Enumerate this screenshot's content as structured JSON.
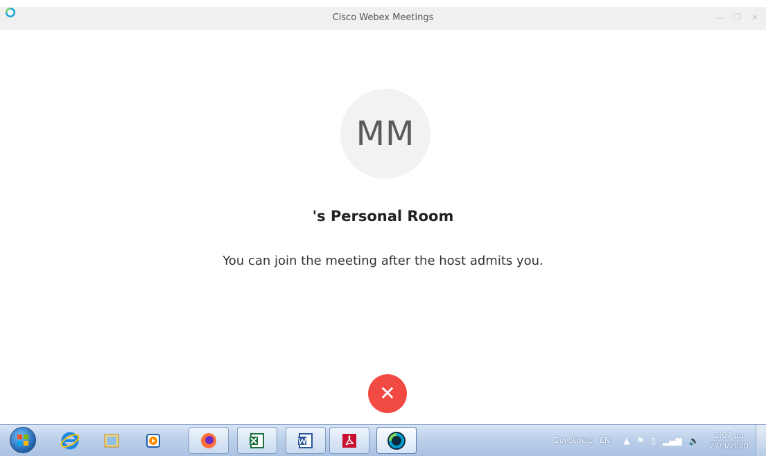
{
  "window": {
    "title": "Cisco Webex Meetings",
    "controls": {
      "minimize": "—",
      "restore": "❐",
      "close": "✕"
    }
  },
  "meeting": {
    "avatar_initials": "MM",
    "room_title": "'s Personal Room",
    "status_message": "You can join the meeting after the host admits you.",
    "leave_symbol": "✕"
  },
  "taskbar": {
    "items": [
      {
        "name": "internet-explorer-icon",
        "running": false
      },
      {
        "name": "library-icon",
        "running": false
      },
      {
        "name": "media-player-icon",
        "running": false
      },
      {
        "name": "firefox-icon",
        "running": true
      },
      {
        "name": "excel-icon",
        "running": true
      },
      {
        "name": "word-icon",
        "running": true
      },
      {
        "name": "acrobat-icon",
        "running": true
      },
      {
        "name": "webex-icon",
        "running": true,
        "active": true
      }
    ],
    "tray": {
      "connections_label": "Συνδέσεις",
      "language": "EN",
      "show_hidden": "▲",
      "time": "2:07 μμ",
      "date": "27/3/2020"
    }
  },
  "colors": {
    "accent_leave": "#f04a43",
    "avatar_bg": "#f2f2f2",
    "webex_blue": "#00a0d1"
  }
}
